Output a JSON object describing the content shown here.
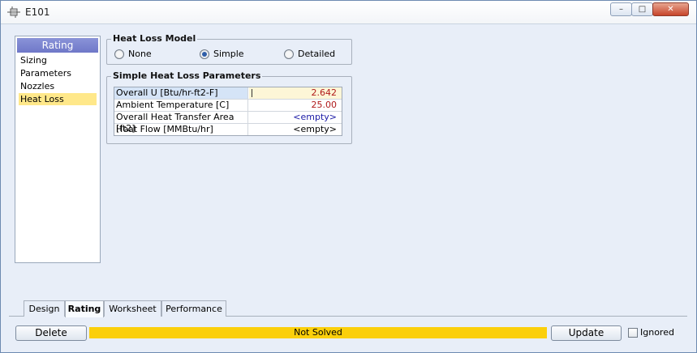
{
  "window": {
    "title": "E101",
    "controls": {
      "minimize": "–",
      "maximize": "□",
      "close": "✕"
    }
  },
  "nav": {
    "header": "Rating",
    "items": [
      "Sizing",
      "Parameters",
      "Nozzles",
      "Heat Loss"
    ],
    "selected": "Heat Loss"
  },
  "heat_loss_model": {
    "label": "Heat Loss Model",
    "options": [
      "None",
      "Simple",
      "Detailed"
    ],
    "selected": "Simple"
  },
  "simple_params": {
    "label": "Simple Heat Loss Parameters",
    "rows": [
      {
        "label": "Overall U [Btu/hr-ft2-F]",
        "value": "2.642"
      },
      {
        "label": "Ambient Temperature [C]",
        "value": "25.00"
      },
      {
        "label": "Overall Heat Transfer Area [ft2]",
        "value": "<empty>"
      },
      {
        "label": "Heat Flow [MMBtu/hr]",
        "value": "<empty>"
      }
    ]
  },
  "tabs": [
    "Design",
    "Rating",
    "Worksheet",
    "Performance"
  ],
  "active_tab": "Rating",
  "footer": {
    "delete_label": "Delete",
    "status": "Not Solved",
    "update_label": "Update",
    "ignored_label": "Ignored",
    "ignored_checked": false
  },
  "colors": {
    "status_bg": "#fbcf0b",
    "nav_header": "#7a83cf",
    "nav_selected": "#ffe88a",
    "value_red": "#b01a1a",
    "value_blue": "#1a1aa6"
  }
}
